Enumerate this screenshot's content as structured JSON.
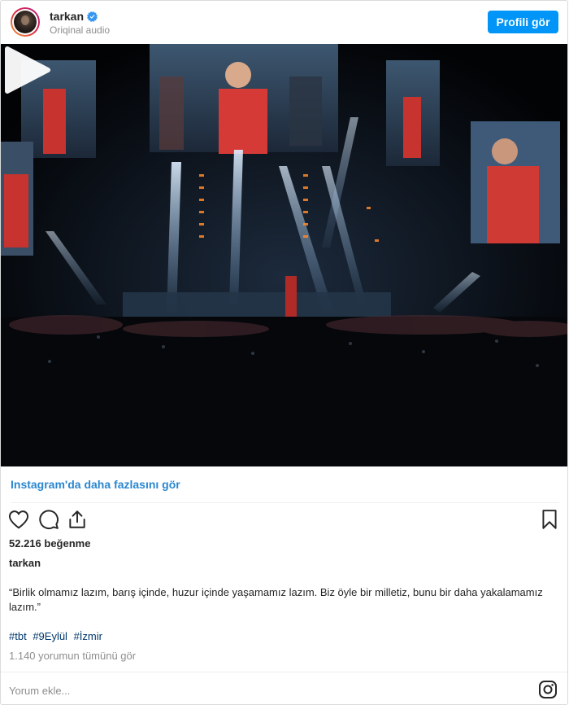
{
  "header": {
    "username": "tarkan",
    "subtitle": "Oriqinal audio",
    "profile_button": "Profili gör"
  },
  "media": {
    "type": "video",
    "play_icon": "play-icon"
  },
  "more_link": "Instagram'da daha fazlasını gör",
  "actions": {
    "like_icon": "heart-icon",
    "comment_icon": "comment-icon",
    "share_icon": "share-icon",
    "save_icon": "bookmark-icon"
  },
  "likes": "52.216 beğenme",
  "caption": {
    "username": "tarkan",
    "text": "“Birlik olmamız lazım, barış içinde, huzur içinde yaşamamız lazım. Biz öyle bir milletiz, bunu bir daha yakalamamız lazım.”",
    "hashtags": [
      "#tbt",
      "#9Eylül",
      "#İzmir"
    ]
  },
  "comments_link": "1.140 yorumun tümünü gör",
  "comment_input": {
    "placeholder": "Yorum ekle..."
  },
  "colors": {
    "primary_button": "#0095f6",
    "link": "#2a87d0",
    "hashtag": "#00376b",
    "muted_text": "#8e8e8e"
  }
}
